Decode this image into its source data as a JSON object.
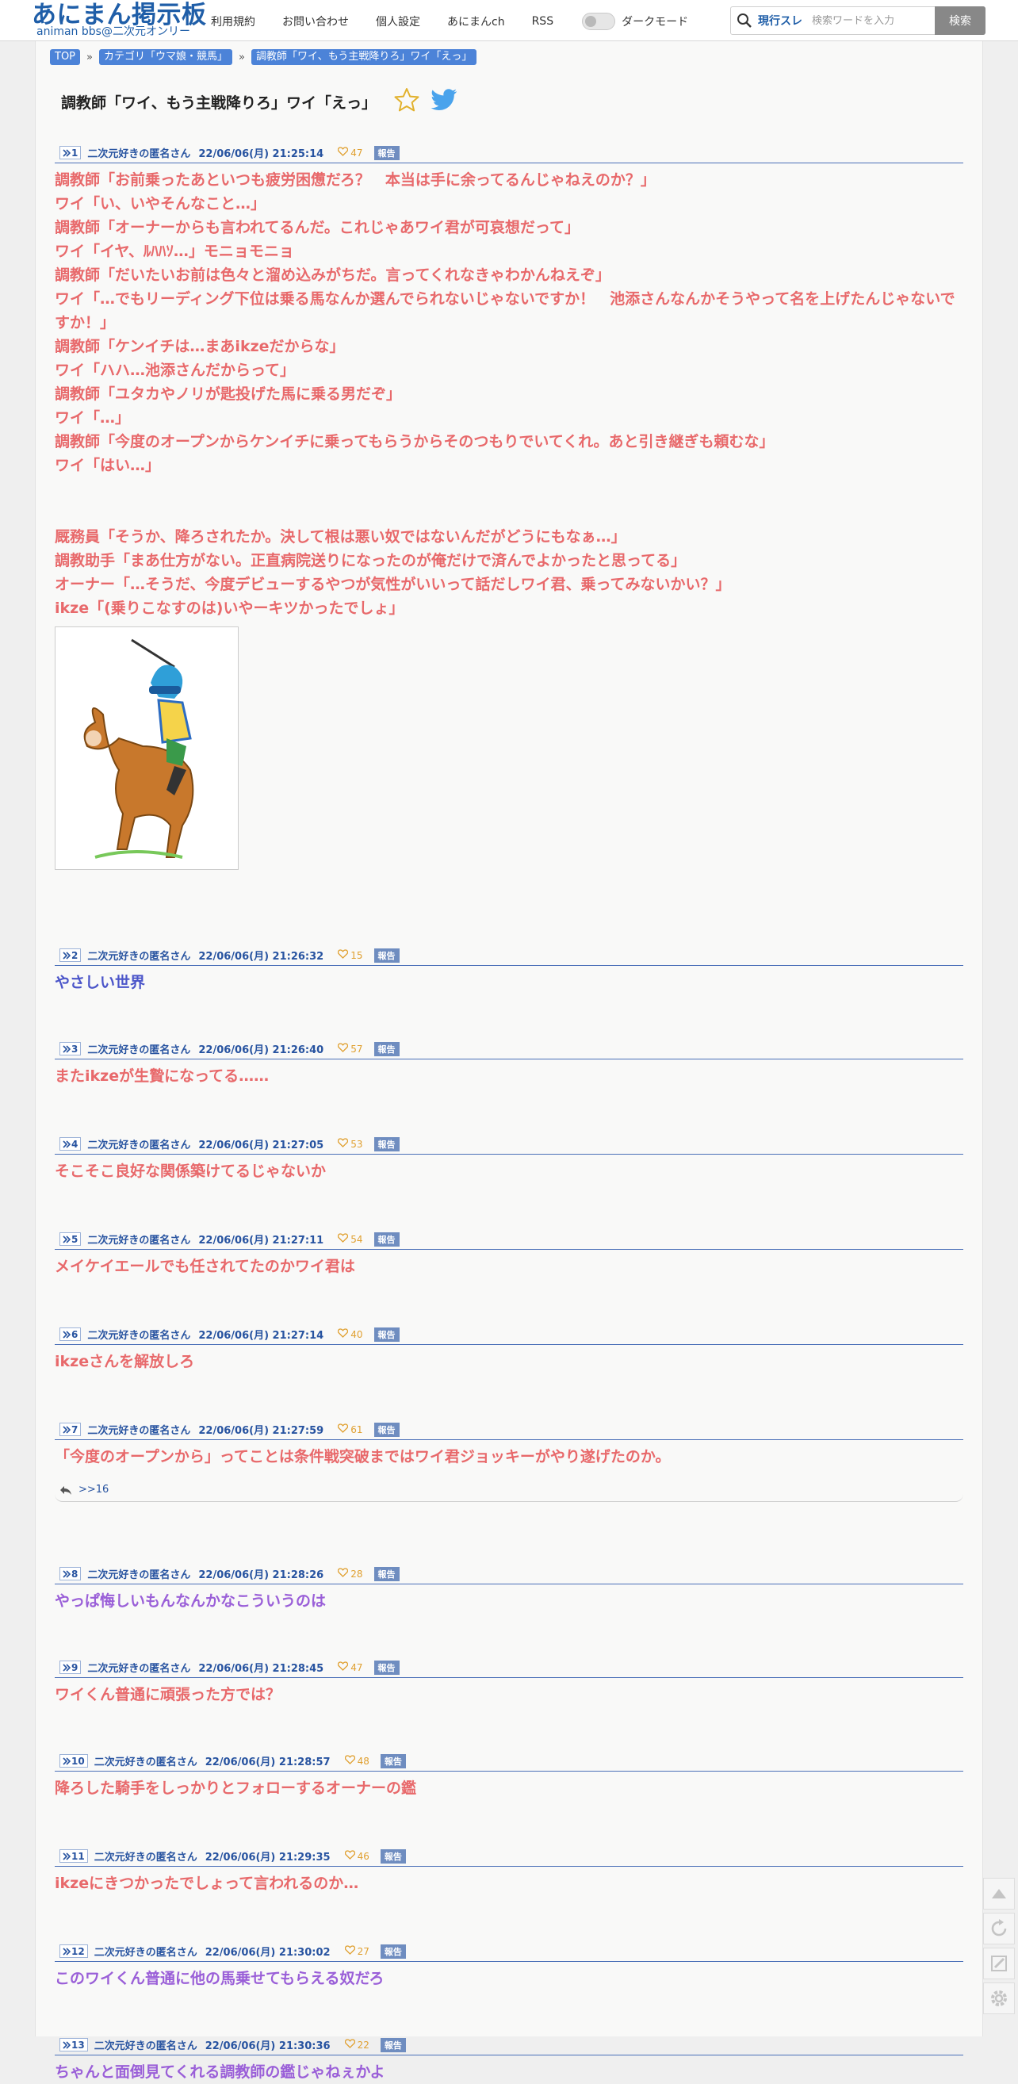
{
  "header": {
    "logo": "あにまん掲示板",
    "logo_sub": "animan bbs@二次元オンリー",
    "nav": [
      "利用規約",
      "お問い合わせ",
      "個人設定",
      "あにまんch",
      "RSS"
    ],
    "dark_mode_label": "ダークモード",
    "search_scope": "現行スレ",
    "search_placeholder": "検索ワードを入力",
    "search_button": "検索"
  },
  "breadcrumb": [
    "TOP",
    "カテゴリ「ウマ娘・競馬」",
    "調教師「ワイ、もう主戦降りろ」ワイ「えっ」"
  ],
  "breadcrumb_sep": "»",
  "thread_title": "調教師「ワイ、もう主戦降りろ」ワイ「えっ」",
  "report_label": "報告",
  "posts": [
    {
      "num": "1",
      "name": "二次元好きの匿名さん",
      "date": "22/06/06(月) 21:25:14",
      "likes": "47",
      "color": "#e8696b",
      "lines": [
        "調教師「お前乗ったあといつも疲労困憊だろ？　本当は手に余ってるんじゃねえのか？」",
        "ワイ「い、いやそんなこと…」",
        "調教師「オーナーからも言われてるんだ。これじゃあワイ君が可哀想だって」",
        "ワイ「イヤ、ﾙﾊﾊｿ…」モニョモニョ",
        "調教師「だいたいお前は色々と溜め込みがちだ。言ってくれなきゃわかんねえぞ」",
        "ワイ「…でもリーディング下位は乗る馬なんか選んでられないじゃないですか！　池添さんなんかそうやって名を上げたんじゃないですか！」",
        "調教師「ケンイチは…まあikzeだからな」",
        "ワイ「ハハ…池添さんだからって」",
        "調教師「ユタカやノリが匙投げた馬に乗る男だぞ」",
        "ワイ「…」",
        "調教師「今度のオープンからケンイチに乗ってもらうからそのつもりでいてくれ。あと引き継ぎも頼むな」",
        "ワイ「はい…」",
        "",
        "",
        "厩務員「そうか、降ろされたか。決して根は悪い奴ではないんだがどうにもなぁ…」",
        "調教助手「まあ仕方がない。正直病院送りになったのが俺だけで済んでよかったと思ってる」",
        "オーナー「…そうだ、今度デビューするやつが気性がいいって話だしワイ君、乗ってみないかい？」",
        "ikze「(乗りこなすのは)いやーキツかったでしょ」"
      ],
      "has_image": true
    },
    {
      "num": "2",
      "name": "二次元好きの匿名さん",
      "date": "22/06/06(月) 21:26:32",
      "likes": "15",
      "color": "#4b55c9",
      "lines": [
        "やさしい世界"
      ]
    },
    {
      "num": "3",
      "name": "二次元好きの匿名さん",
      "date": "22/06/06(月) 21:26:40",
      "likes": "57",
      "color": "#e8696b",
      "lines": [
        "またikzeが生贄になってる……"
      ]
    },
    {
      "num": "4",
      "name": "二次元好きの匿名さん",
      "date": "22/06/06(月) 21:27:05",
      "likes": "53",
      "color": "#e8696b",
      "lines": [
        "そこそこ良好な関係築けてるじゃないか"
      ]
    },
    {
      "num": "5",
      "name": "二次元好きの匿名さん",
      "date": "22/06/06(月) 21:27:11",
      "likes": "54",
      "color": "#e8696b",
      "lines": [
        "メイケイエールでも任されてたのかワイ君は"
      ]
    },
    {
      "num": "6",
      "name": "二次元好きの匿名さん",
      "date": "22/06/06(月) 21:27:14",
      "likes": "40",
      "color": "#e8696b",
      "lines": [
        "ikzeさんを解放しろ"
      ]
    },
    {
      "num": "7",
      "name": "二次元好きの匿名さん",
      "date": "22/06/06(月) 21:27:59",
      "likes": "61",
      "color": "#e8696b",
      "lines": [
        "「今度のオープンから」ってことは条件戦突破まではワイ君ジョッキーがやり遂げたのか。"
      ],
      "reply": ">>16"
    },
    {
      "num": "8",
      "name": "二次元好きの匿名さん",
      "date": "22/06/06(月) 21:28:26",
      "likes": "28",
      "color": "#9a5fd8",
      "lines": [
        "やっぱ悔しいもんなんかなこういうのは"
      ]
    },
    {
      "num": "9",
      "name": "二次元好きの匿名さん",
      "date": "22/06/06(月) 21:28:45",
      "likes": "47",
      "color": "#e8696b",
      "lines": [
        "ワイくん普通に頑張った方では？"
      ]
    },
    {
      "num": "10",
      "name": "二次元好きの匿名さん",
      "date": "22/06/06(月) 21:28:57",
      "likes": "48",
      "color": "#e8696b",
      "lines": [
        "降ろした騎手をしっかりとフォローするオーナーの鑑"
      ]
    },
    {
      "num": "11",
      "name": "二次元好きの匿名さん",
      "date": "22/06/06(月) 21:29:35",
      "likes": "46",
      "color": "#e8696b",
      "lines": [
        "ikzeにきつかったでしょって言われるのか…"
      ]
    },
    {
      "num": "12",
      "name": "二次元好きの匿名さん",
      "date": "22/06/06(月) 21:30:02",
      "likes": "27",
      "color": "#9a5fd8",
      "lines": [
        "このワイくん普通に他の馬乗せてもらえる奴だろ"
      ]
    },
    {
      "num": "13",
      "name": "二次元好きの匿名さん",
      "date": "22/06/06(月) 21:30:36",
      "likes": "22",
      "color": "#9a5fd8",
      "lines": [
        "ちゃんと面倒見てくれる調教師の鑑じゃねぇかよ"
      ]
    }
  ]
}
